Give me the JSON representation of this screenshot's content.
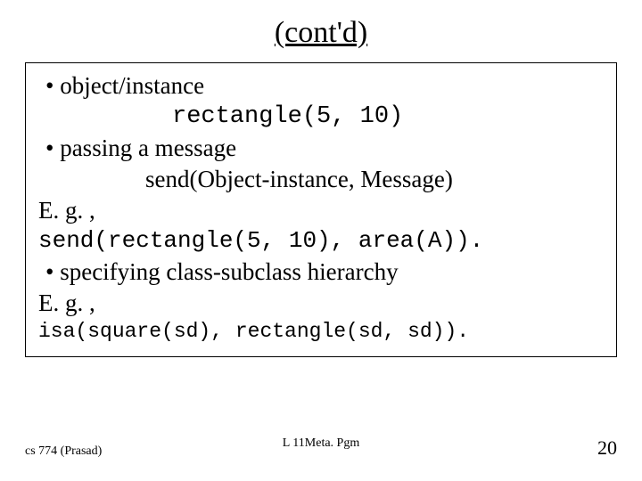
{
  "title": "(cont'd)",
  "lines": {
    "b1": "• object/instance",
    "l1": "rectangle(5, 10)",
    "b2": "• passing a message",
    "l2": "send(Object-instance, Message)",
    "eg1": "E. g. ,",
    "l3": "send(rectangle(5, 10), area(A)).",
    "b3": "• specifying class-subclass hierarchy",
    "eg2": "E. g. ,",
    "l4": "isa(square(sd), rectangle(sd, sd))."
  },
  "footer": {
    "left": "cs 774 (Prasad)",
    "center": "L 11Meta. Pgm",
    "right": "20"
  }
}
